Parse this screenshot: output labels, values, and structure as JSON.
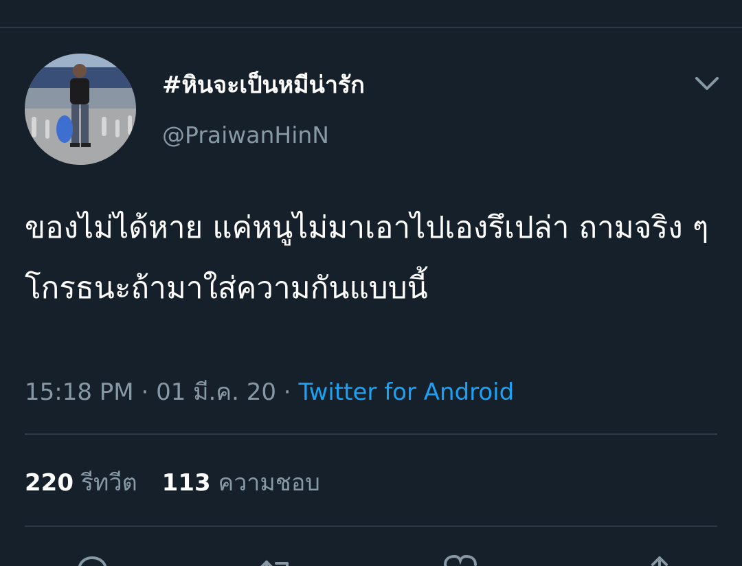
{
  "tweet": {
    "display_name": "#หินจะเป็นหมีน่ารัก",
    "handle": "@PraiwanHinN",
    "text": "ของไม่ได้หาย แค่หนูไม่มาเอาไปเองรึเปล่า ถามจริง ๆ  โกรธนะถ้ามาใส่ความกันแบบนี้",
    "time": "15:18 PM",
    "separator": " · ",
    "date": "01 มี.ค. 20",
    "source": "Twitter for Android"
  },
  "stats": {
    "retweets_count": "220",
    "retweets_label": "รีทวีต",
    "likes_count": "113",
    "likes_label": "ความชอบ"
  },
  "icons": {
    "menu": "chevron-down-icon",
    "reply": "reply-icon",
    "retweet": "retweet-icon",
    "like": "heart-icon",
    "share": "share-icon"
  },
  "colors": {
    "background": "#15202b",
    "primary_text": "#ffffff",
    "secondary_text": "#8899a6",
    "accent": "#1da1f2",
    "divider": "#2b3946"
  }
}
